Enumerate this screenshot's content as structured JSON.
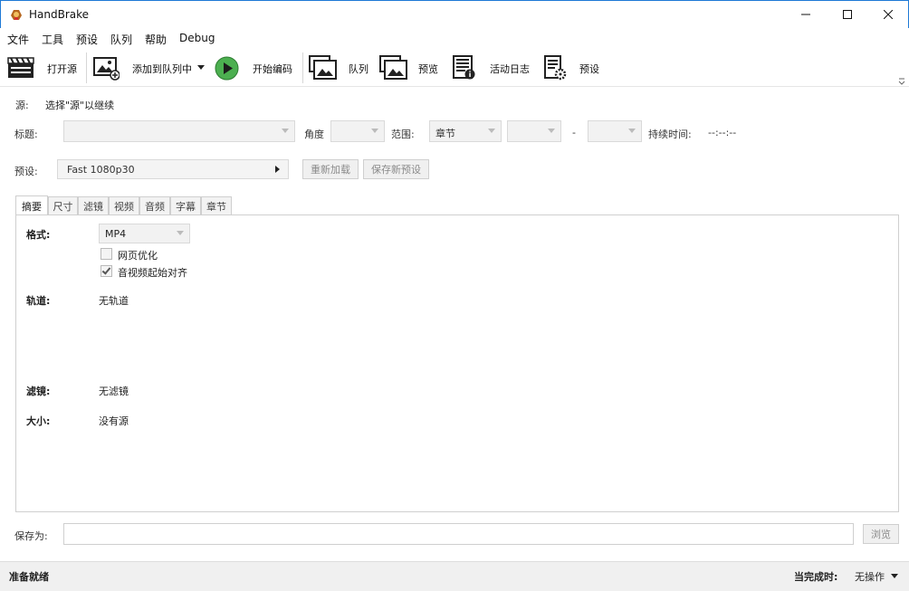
{
  "window": {
    "title": "HandBrake"
  },
  "menu": [
    "文件",
    "工具",
    "预设",
    "队列",
    "帮助",
    "Debug"
  ],
  "toolbar": {
    "open_source": "打开源",
    "add_to_queue": "添加到队列中",
    "start_encode": "开始编码",
    "queue": "队列",
    "preview": "预览",
    "activity_log": "活动日志",
    "presets": "预设"
  },
  "source": {
    "label": "源:",
    "value": "选择\"源\"以继续"
  },
  "title_row": {
    "title_label": "标题:",
    "angle_label": "角度",
    "range_label": "范围:",
    "range_value": "章节",
    "dash": "-",
    "duration_label": "持续时间:",
    "duration_value": "--:--:--"
  },
  "preset_row": {
    "label": "预设:",
    "value": "Fast 1080p30",
    "reload_button": "重新加载",
    "save_new_button": "保存新预设"
  },
  "tabs": [
    "摘要",
    "尺寸",
    "滤镜",
    "视频",
    "音频",
    "字幕",
    "章节"
  ],
  "summary": {
    "format_label": "格式:",
    "format_value": "MP4",
    "web_optimize": "网页优化",
    "web_optimize_checked": false,
    "align_av": "音视频起始对齐",
    "align_av_checked": true,
    "tracks_label": "轨道:",
    "tracks_value": "无轨道",
    "filters_label": "滤镜:",
    "filters_value": "无滤镜",
    "size_label": "大小:",
    "size_value": "没有源"
  },
  "save_as": {
    "label": "保存为:",
    "value": "",
    "browse_button": "浏览"
  },
  "status": {
    "text": "准备就绪",
    "when_done_label": "当完成时:",
    "when_done_value": "无操作"
  },
  "colors": {
    "title_border": "#1e79d6",
    "play_green": "#4caf50",
    "statusbar": "#f0f0f0"
  }
}
